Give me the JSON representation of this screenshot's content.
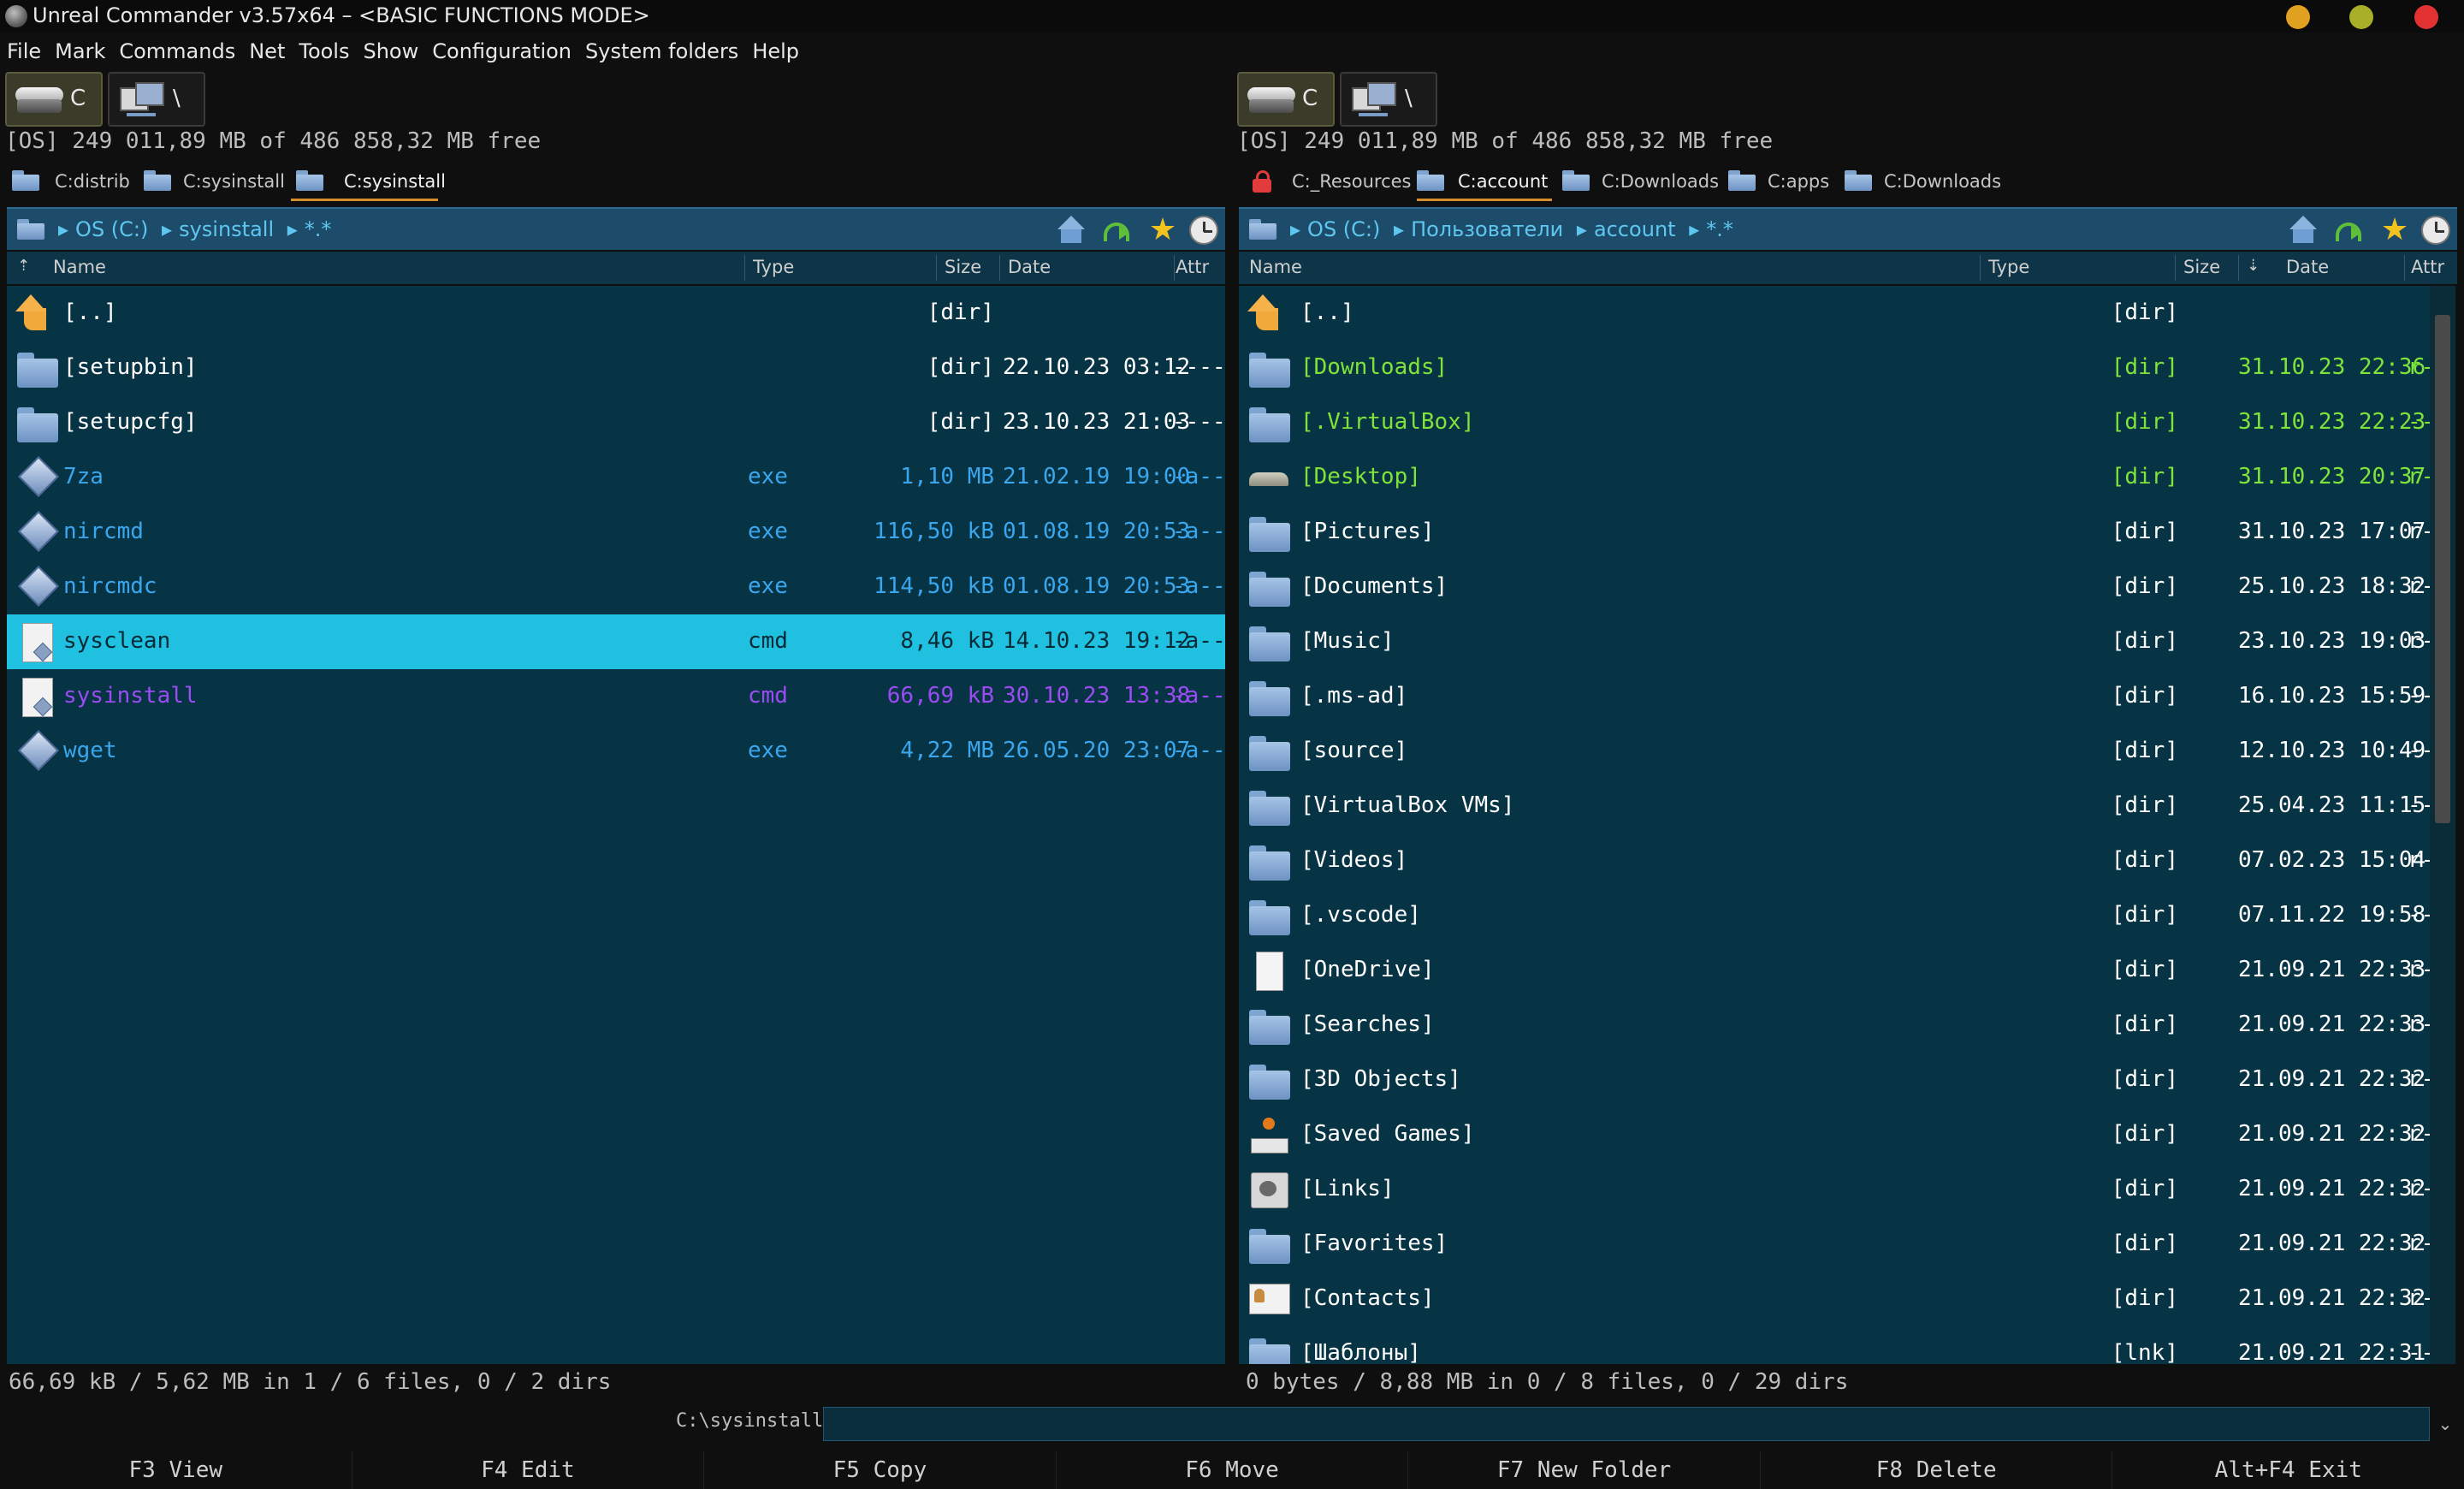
{
  "window": {
    "title": "Unreal Commander v3.57x64 – <BASIC FUNCTIONS MODE>",
    "controls": {
      "minimize_color": "#e0a020",
      "maximize_color": "#a8b02a",
      "close_color": "#e23232"
    }
  },
  "menu": [
    "File",
    "Mark",
    "Commands",
    "Net",
    "Tools",
    "Show",
    "Configuration",
    "System folders",
    "Help"
  ],
  "left": {
    "drive_label": "C",
    "net_label": "\\",
    "free_info": "[OS]  249 011,89 MB of 486 858,32 MB free",
    "tabs": [
      "C:distrib",
      "C:sysinstall",
      "C:sysinstall"
    ],
    "active_tab": 2,
    "path": [
      "OS (C:)",
      "sysinstall",
      "*.*"
    ],
    "columns": {
      "name": "Name",
      "type": "Type",
      "size": "Size",
      "date": "Date",
      "attr": "Attr"
    },
    "rows": [
      {
        "icon": "up-icon",
        "name": "[..]",
        "type": "",
        "size": "[dir]",
        "date": "",
        "attr": "",
        "color": "#ffffff"
      },
      {
        "icon": "folder-icon",
        "name": "[setupbin]",
        "type": "",
        "size": "[dir]",
        "date": "22.10.23 03:12",
        "attr": "----",
        "color": "#ffffff"
      },
      {
        "icon": "folder-icon",
        "name": "[setupcfg]",
        "type": "",
        "size": "[dir]",
        "date": "23.10.23 21:03",
        "attr": "----",
        "color": "#ffffff"
      },
      {
        "icon": "exe-icon",
        "name": "7za",
        "type": "exe",
        "size": "1,10  MB",
        "date": "21.02.19 19:00",
        "attr": "-a--",
        "color": "#3aa6ee"
      },
      {
        "icon": "exe-icon",
        "name": "nircmd",
        "type": "exe",
        "size": "116,50  kB",
        "date": "01.08.19 20:53",
        "attr": "-a--",
        "color": "#3aa6ee"
      },
      {
        "icon": "exe-icon",
        "name": "nircmdc",
        "type": "exe",
        "size": "114,50  kB",
        "date": "01.08.19 20:53",
        "attr": "-a--",
        "color": "#3aa6ee"
      },
      {
        "icon": "cmd-icon",
        "name": "sysclean",
        "type": "cmd",
        "size": "8,46  kB",
        "date": "14.10.23 19:12",
        "attr": "-a--",
        "color": "#0b2a35",
        "selected": true
      },
      {
        "icon": "cmd-icon",
        "name": "sysinstall",
        "type": "cmd",
        "size": "66,69  kB",
        "date": "30.10.23 13:38",
        "attr": "-a--",
        "color": "#9a4cf2"
      },
      {
        "icon": "exe-icon",
        "name": "wget",
        "type": "exe",
        "size": "4,22  MB",
        "date": "26.05.20 23:07",
        "attr": "-a--",
        "color": "#3aa6ee"
      }
    ],
    "status": "66,69 kB / 5,62 MB in 1 / 6 files, 0 / 2 dirs"
  },
  "right": {
    "drive_label": "C",
    "net_label": "\\",
    "free_info": "[OS]  249 011,89 MB of 486 858,32 MB free",
    "tabs": [
      "C:_Resources",
      "C:account",
      "C:Downloads",
      "C:apps",
      "C:Downloads"
    ],
    "active_tab": 1,
    "path": [
      "OS (C:)",
      "Пользователи",
      "account",
      "*.*"
    ],
    "columns": {
      "name": "Name",
      "type": "Type",
      "size": "Size",
      "date": "Date",
      "attr": "Attr"
    },
    "rows": [
      {
        "icon": "up-icon",
        "name": "[..]",
        "size": "[dir]",
        "date": "",
        "attr": "",
        "color": "#ffffff"
      },
      {
        "icon": "downloads-folder-icon",
        "name": "[Downloads]",
        "size": "[dir]",
        "date": "31.10.23 22:36",
        "attr": "r-",
        "color": "#7fe33a"
      },
      {
        "icon": "folder-icon",
        "name": "[.VirtualBox]",
        "size": "[dir]",
        "date": "31.10.23 22:23",
        "attr": "--",
        "color": "#7fe33a"
      },
      {
        "icon": "desktop-icon",
        "name": "[Desktop]",
        "size": "[dir]",
        "date": "31.10.23 20:37",
        "attr": "r-",
        "color": "#7fe33a"
      },
      {
        "icon": "pictures-folder-icon",
        "name": "[Pictures]",
        "size": "[dir]",
        "date": "31.10.23 17:07",
        "attr": "r-",
        "color": "#ffffff"
      },
      {
        "icon": "documents-folder-icon",
        "name": "[Documents]",
        "size": "[dir]",
        "date": "25.10.23 18:32",
        "attr": "r-",
        "color": "#ffffff"
      },
      {
        "icon": "music-folder-icon",
        "name": "[Music]",
        "size": "[dir]",
        "date": "23.10.23 19:03",
        "attr": "r-",
        "color": "#ffffff"
      },
      {
        "icon": "folder-icon",
        "name": "[.ms-ad]",
        "size": "[dir]",
        "date": "16.10.23 15:59",
        "attr": "--",
        "color": "#ffffff"
      },
      {
        "icon": "folder-icon",
        "name": "[source]",
        "size": "[dir]",
        "date": "12.10.23 10:49",
        "attr": "--",
        "color": "#ffffff"
      },
      {
        "icon": "folder-icon",
        "name": "[VirtualBox VMs]",
        "size": "[dir]",
        "date": "25.04.23 11:15",
        "attr": "--",
        "color": "#ffffff"
      },
      {
        "icon": "videos-folder-icon",
        "name": "[Videos]",
        "size": "[dir]",
        "date": "07.02.23 15:04",
        "attr": "r-",
        "color": "#ffffff"
      },
      {
        "icon": "folder-icon",
        "name": "[.vscode]",
        "size": "[dir]",
        "date": "07.11.22 19:58",
        "attr": "--",
        "color": "#ffffff"
      },
      {
        "icon": "document-icon",
        "name": "[OneDrive]",
        "size": "[dir]",
        "date": "21.09.21 22:33",
        "attr": "r-",
        "color": "#ffffff"
      },
      {
        "icon": "searches-folder-icon",
        "name": "[Searches]",
        "size": "[dir]",
        "date": "21.09.21 22:33",
        "attr": "r-",
        "color": "#ffffff"
      },
      {
        "icon": "3d-objects-folder-icon",
        "name": "[3D Objects]",
        "size": "[dir]",
        "date": "21.09.21 22:32",
        "attr": "r-",
        "color": "#ffffff"
      },
      {
        "icon": "joystick-icon",
        "name": "[Saved Games]",
        "size": "[dir]",
        "date": "21.09.21 22:32",
        "attr": "r-",
        "color": "#ffffff"
      },
      {
        "icon": "links-icon",
        "name": "[Links]",
        "size": "[dir]",
        "date": "21.09.21 22:32",
        "attr": "r-",
        "color": "#ffffff"
      },
      {
        "icon": "favorites-folder-icon",
        "name": "[Favorites]",
        "size": "[dir]",
        "date": "21.09.21 22:32",
        "attr": "r-",
        "color": "#ffffff"
      },
      {
        "icon": "contacts-icon",
        "name": "[Contacts]",
        "size": "[dir]",
        "date": "21.09.21 22:32",
        "attr": "r-",
        "color": "#ffffff"
      },
      {
        "icon": "link-folder-icon",
        "name": "[Шаблоны]",
        "size": "[lnk]",
        "date": "21.09.21 22:31",
        "attr": "--",
        "color": "#ffffff"
      }
    ],
    "status": "0 bytes / 8,88 MB in 0 / 8 files, 0 / 29 dirs"
  },
  "command_line": {
    "prompt": "C:\\sysinstall\\>",
    "value": ""
  },
  "function_keys": [
    "F3 View",
    "F4 Edit",
    "F5 Copy",
    "F6 Move",
    "F7 New Folder",
    "F8 Delete",
    "Alt+F4 Exit"
  ],
  "colors": {
    "panel_bg": "#073445",
    "path_bar": "#1d4c6b",
    "selection": "#1fc0e0",
    "exe_text": "#3aa6ee",
    "cmd_text": "#9a4cf2",
    "hidden_text": "#7fe33a"
  }
}
